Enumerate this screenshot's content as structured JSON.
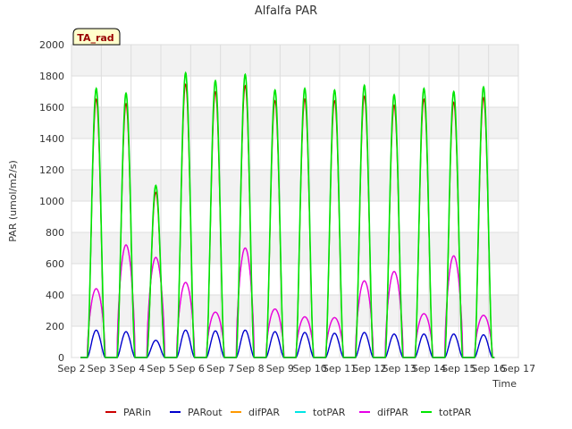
{
  "chart_data": {
    "type": "line",
    "title": "Alfalfa PAR",
    "xlabel": "Time",
    "ylabel": "PAR (umol/m2/s)",
    "ylim": [
      0,
      2000
    ],
    "yticks": [
      0,
      200,
      400,
      600,
      800,
      1000,
      1200,
      1400,
      1600,
      1800,
      2000
    ],
    "xlim": [
      0,
      15
    ],
    "xticks": [
      {
        "x": 0,
        "label": "Sep 2"
      },
      {
        "x": 1,
        "label": "Sep 3"
      },
      {
        "x": 2,
        "label": "Sep 4"
      },
      {
        "x": 3,
        "label": "Sep 5"
      },
      {
        "x": 4,
        "label": "Sep 6"
      },
      {
        "x": 5,
        "label": "Sep 7"
      },
      {
        "x": 6,
        "label": "Sep 8"
      },
      {
        "x": 7,
        "label": "Sep 9"
      },
      {
        "x": 8,
        "label": "Sep 10"
      },
      {
        "x": 9,
        "label": "Sep 11"
      },
      {
        "x": 10,
        "label": "Sep 12"
      },
      {
        "x": 11,
        "label": "Sep 13"
      },
      {
        "x": 12,
        "label": "Sep 14"
      },
      {
        "x": 13,
        "label": "Sep 15"
      },
      {
        "x": 14,
        "label": "Sep 16"
      },
      {
        "x": 15,
        "label": "Sep 17"
      }
    ],
    "grid": true,
    "legend_position": "bottom",
    "badge": "TA_rad",
    "days": [
      {
        "center": 0.83,
        "tot": 1720,
        "diff": 440,
        "out": 175
      },
      {
        "center": 1.83,
        "tot": 1690,
        "diff": 720,
        "out": 165
      },
      {
        "center": 2.83,
        "tot": 1100,
        "diff": 640,
        "out": 110
      },
      {
        "center": 3.83,
        "tot": 1820,
        "diff": 480,
        "out": 175
      },
      {
        "center": 4.83,
        "tot": 1770,
        "diff": 290,
        "out": 170
      },
      {
        "center": 5.83,
        "tot": 1810,
        "diff": 700,
        "out": 175
      },
      {
        "center": 6.83,
        "tot": 1710,
        "diff": 310,
        "out": 165
      },
      {
        "center": 7.83,
        "tot": 1720,
        "diff": 260,
        "out": 160
      },
      {
        "center": 8.83,
        "tot": 1710,
        "diff": 255,
        "out": 155
      },
      {
        "center": 9.83,
        "tot": 1740,
        "diff": 490,
        "out": 160
      },
      {
        "center": 10.83,
        "tot": 1680,
        "diff": 550,
        "out": 150
      },
      {
        "center": 11.83,
        "tot": 1720,
        "diff": 280,
        "out": 150
      },
      {
        "center": 12.83,
        "tot": 1700,
        "diff": 650,
        "out": 150
      },
      {
        "center": 13.83,
        "tot": 1730,
        "diff": 270,
        "out": 145
      }
    ],
    "series": [
      {
        "name": "PARin",
        "color": "#cc0000"
      },
      {
        "name": "PARout",
        "color": "#0000cc"
      },
      {
        "name": "difPAR",
        "color": "#ff9900"
      },
      {
        "name": "totPAR",
        "color": "#00e5e5"
      },
      {
        "name": "difPAR",
        "color": "#e600e6"
      },
      {
        "name": "totPAR",
        "color": "#00e600"
      }
    ]
  }
}
